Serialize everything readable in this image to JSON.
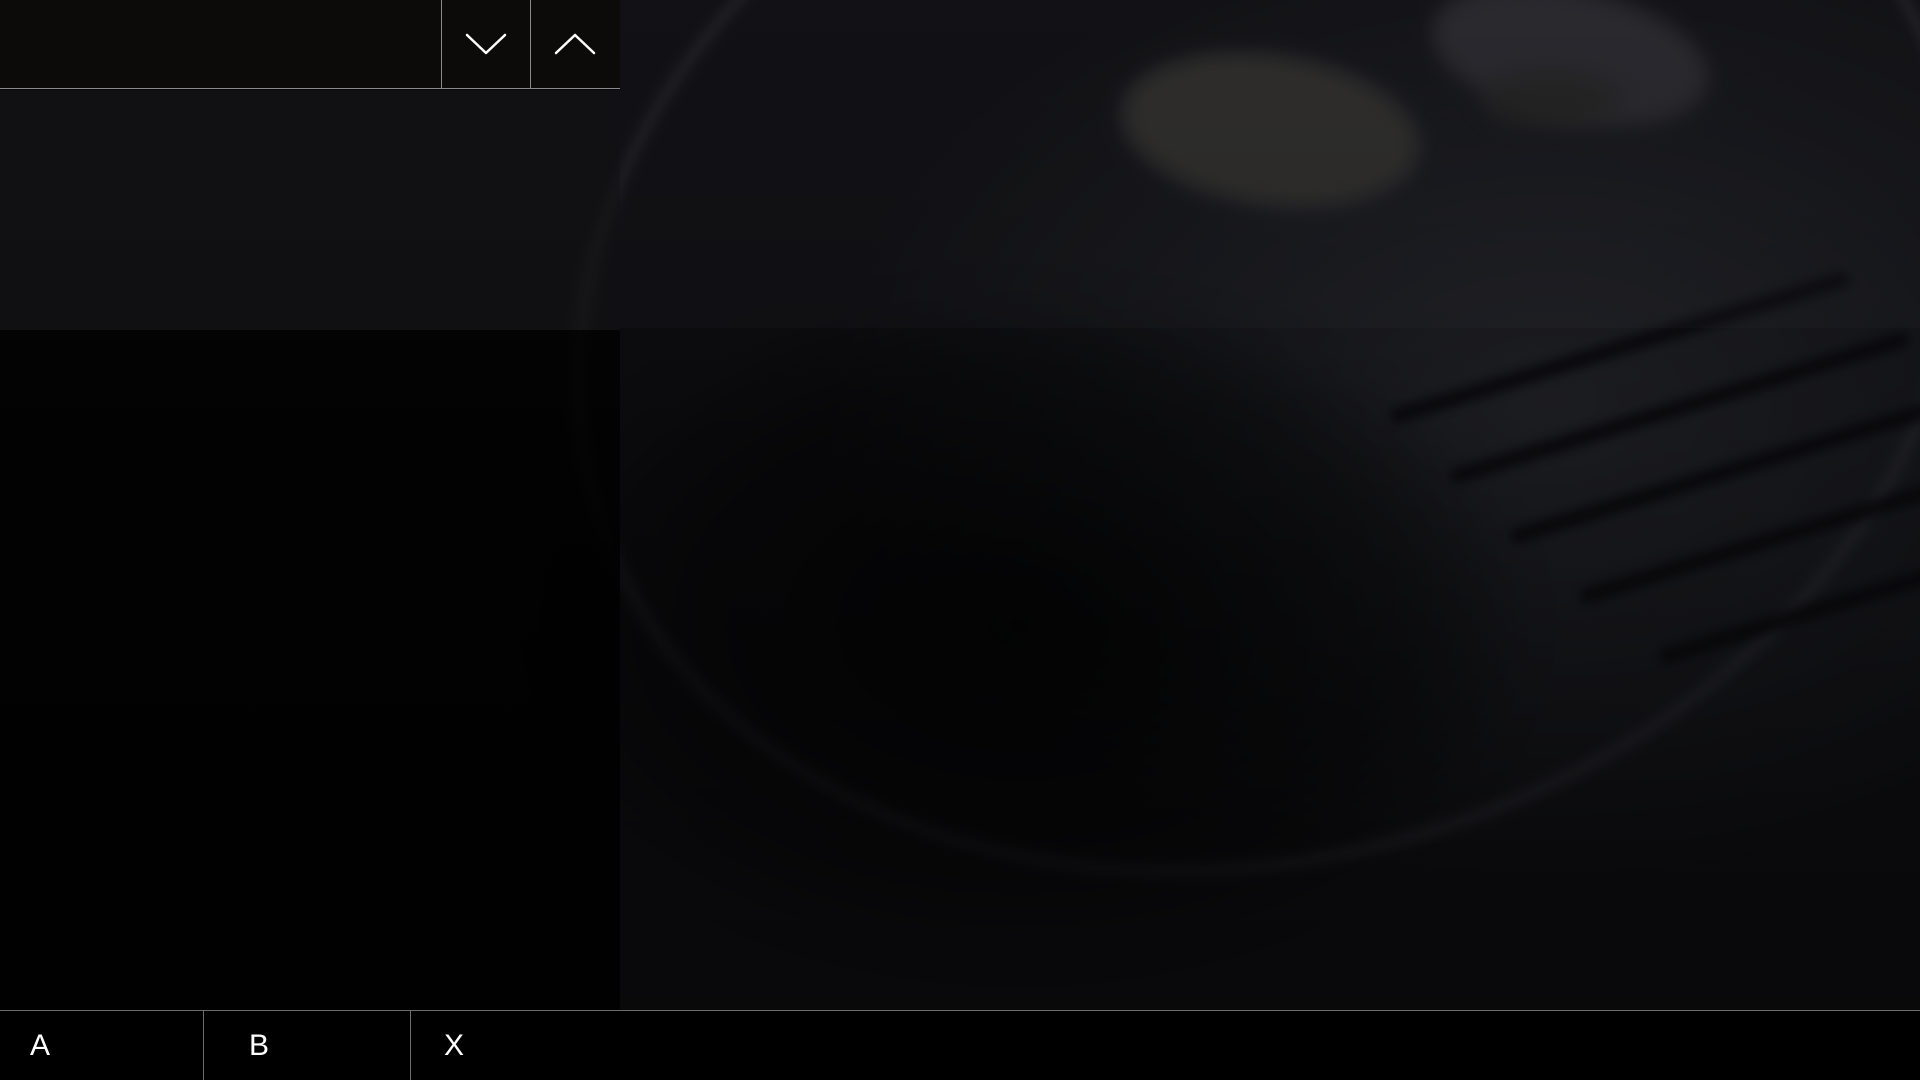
{
  "top_bar": {
    "title": "",
    "scroll_down_icon": "chevron-down-icon",
    "scroll_up_icon": "chevron-up-icon"
  },
  "bottom_bar": {
    "buttons": [
      {
        "label": "A"
      },
      {
        "label": "B"
      },
      {
        "label": "X"
      }
    ]
  },
  "colors": {
    "divider": "#8a8a8a",
    "text": "#ffffff",
    "bottom_bar_background": "#000000"
  }
}
